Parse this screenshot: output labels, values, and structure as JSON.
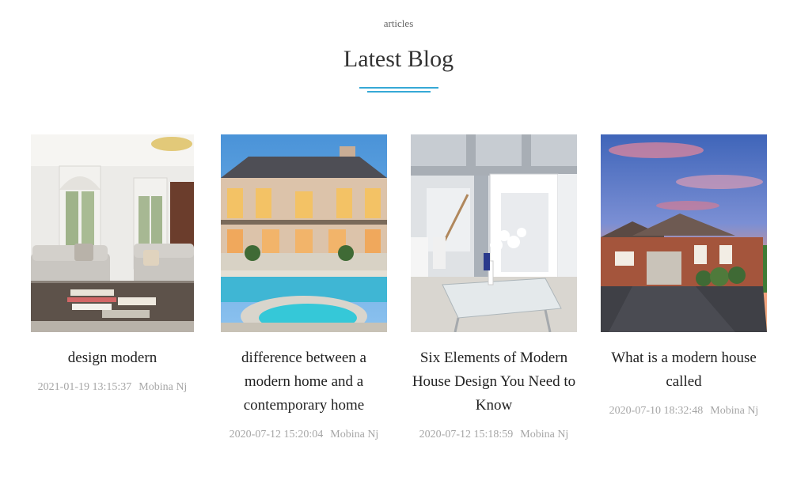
{
  "header": {
    "eyebrow": "articles",
    "title": "Latest Blog"
  },
  "colors": {
    "accent": "#36a9d6",
    "meta_text": "#a6a6a6"
  },
  "posts": [
    {
      "image": "luxury-living-room-photo",
      "title": "design modern",
      "date": "2021-01-19 13:15:37",
      "author": "Mobina Nj"
    },
    {
      "image": "mansion-pool-dusk-photo",
      "title": "difference between a modern home and a contemporary home",
      "date": "2020-07-12 15:20:04",
      "author": "Mobina Nj"
    },
    {
      "image": "interior-glass-table-photo",
      "title": "Six Elements of Modern House Design You Need to Know",
      "date": "2020-07-12 15:18:59",
      "author": "Mobina Nj"
    },
    {
      "image": "brick-house-sunset-photo",
      "title": "What is a modern house called",
      "date": "2020-07-10 18:32:48",
      "author": "Mobina Nj"
    }
  ]
}
